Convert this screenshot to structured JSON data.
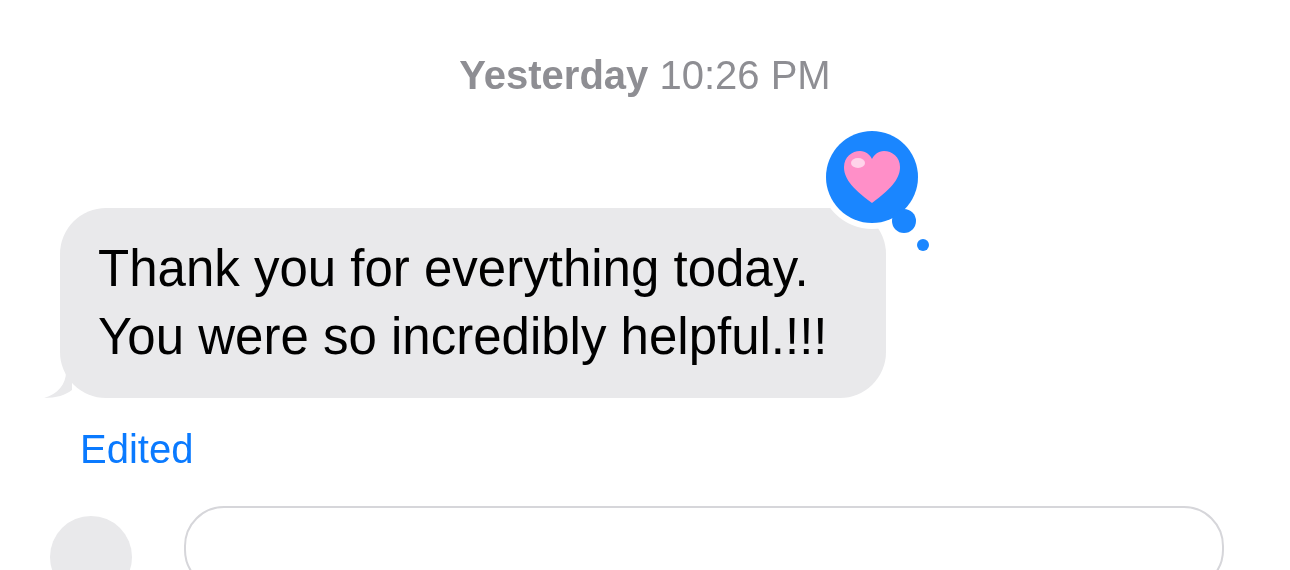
{
  "timestamp": "**Yesterday** 10:26 PM",
  "message": {
    "text": "Thank you for everything today.\nYou were so incredibly helpful.!!!",
    "reaction": {
      "kind": "heart"
    },
    "status": "Edited"
  }
}
